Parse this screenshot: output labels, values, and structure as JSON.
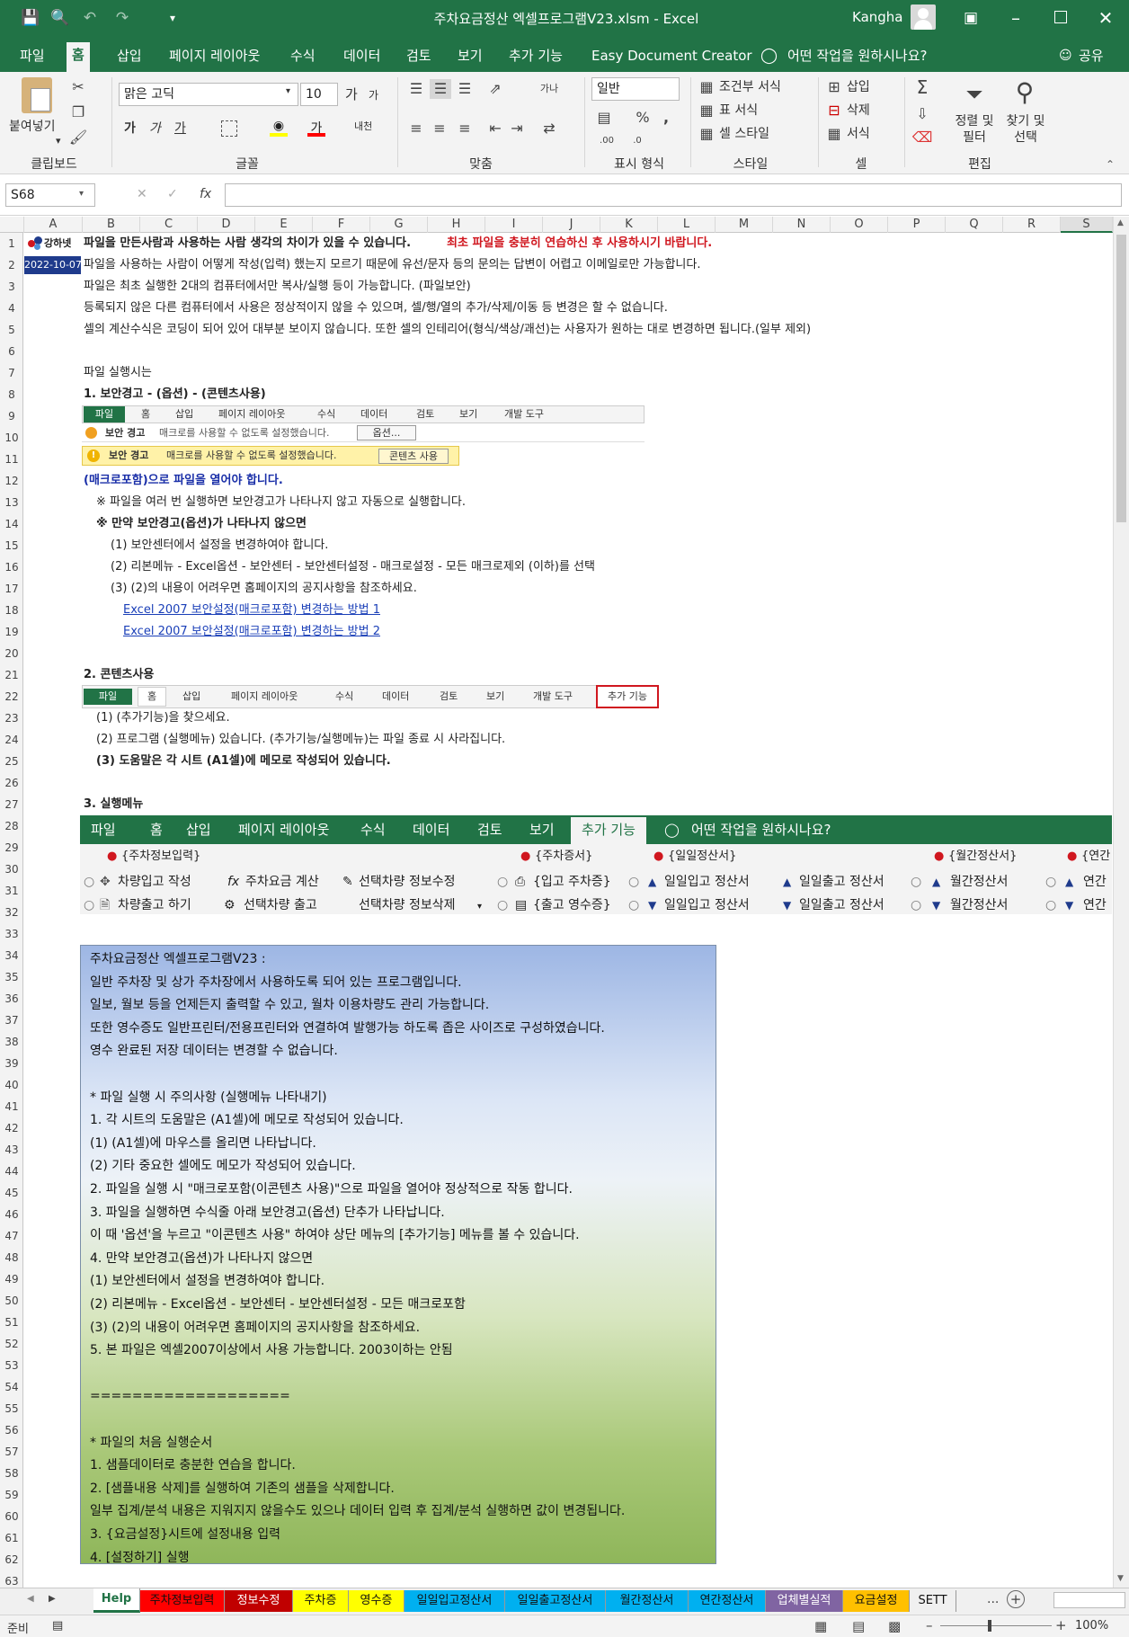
{
  "window": {
    "title": "주차요금정산 엑셀프로그램V23.xlsm  -  Excel",
    "user": "Kangha"
  },
  "menu": {
    "tabs": [
      "파일",
      "홈",
      "삽입",
      "페이지 레이아웃",
      "수식",
      "데이터",
      "검토",
      "보기",
      "추가 기능",
      "Easy Document Creator"
    ],
    "active_index": 1,
    "tell_me": "어떤 작업을 원하시나요?",
    "share": "공유"
  },
  "ribbon": {
    "clipboard": {
      "paste": "붙여넣기",
      "label": "클립보드"
    },
    "font": {
      "name": "맑은 고딕",
      "size": "10",
      "label": "글꼴"
    },
    "alignment": {
      "label": "맞춤"
    },
    "number": {
      "format": "일반",
      "label": "표시 형식"
    },
    "styles": {
      "conditional": "조건부 서식",
      "table": "표 서식",
      "cell": "셀 스타일",
      "label": "스타일"
    },
    "cells": {
      "insert": "삽입",
      "delete": "삭제",
      "format": "서식",
      "label": "셀"
    },
    "editing": {
      "sort": "정렬 및 필터",
      "find": "찾기 및 선택",
      "label": "편집"
    }
  },
  "formula_bar": {
    "name_box": "S68",
    "formula": ""
  },
  "columns": [
    "A",
    "B",
    "C",
    "D",
    "E",
    "F",
    "G",
    "H",
    "I",
    "J",
    "K",
    "L",
    "M",
    "N",
    "O",
    "P",
    "Q",
    "R",
    "S"
  ],
  "rows": [
    "1",
    "2",
    "3",
    "4",
    "5",
    "6",
    "7",
    "8",
    "9",
    "10",
    "11",
    "12",
    "13",
    "14",
    "15",
    "16",
    "17",
    "18",
    "19",
    "20",
    "21",
    "22",
    "23",
    "24",
    "25",
    "26",
    "27",
    "28",
    "29",
    "30",
    "31",
    "32",
    "33",
    "34",
    "35",
    "36",
    "37",
    "38",
    "39",
    "40",
    "41",
    "42",
    "43",
    "44",
    "45",
    "46",
    "47",
    "48",
    "49",
    "50",
    "51",
    "52",
    "53",
    "54",
    "55",
    "56",
    "57",
    "58",
    "59",
    "60",
    "61",
    "62",
    "63"
  ],
  "content": {
    "logo": "강하넷",
    "date": "2022-10-07",
    "r1a": "파일을 만든사람과 사용하는 사람 생각의 차이가 있을 수 있습니다.",
    "r1b": "최초 파일을 충분히 연습하신 후 사용하시기 바랍니다.",
    "r2": "파일을 사용하는 사람이 어떻게 작성(입력) 했는지 모르기 때문에 유선/문자 등의 문의는 답변이 어렵고 이메일로만 가능합니다.",
    "r3": "파일은 최초 실행한 2대의 컴퓨터에서만 복사/실행 등이 가능합니다.  (파일보안)",
    "r4": "등록되지 않은 다른 컴퓨터에서 사용은 정상적이지 않을 수 있으며, 셀/행/열의 추가/삭제/이동 등 변경은 할 수 없습니다.",
    "r5": "셀의 계산수식은 코딩이 되어 있어 대부분 보이지 않습니다. 또한 셀의 인테리어(형식/색상/괘선)는 사용자가 원하는 대로 변경하면 됩니다.(일부 제외)",
    "r7": "파일 실행시는",
    "r8": "1. 보안경고 - (옵션) - (콘텐츠사용)",
    "r12": "(매크로포함)으로 파일을 열어야 합니다.",
    "r13": "※ 파일을 여러 번 실행하면 보안경고가 나타나지 않고 자동으로 실행합니다.",
    "r14": "※ 만약 보안경고(옵션)가 나타나지 않으면",
    "r15": "(1) 보안센터에서 설정을 변경하여야 합니다.",
    "r16": "(2) 리본메뉴 - Excel옵션 - 보안센터 - 보안센터설정 - 매크로설정 - 모든 매크로제외 (이하)를 선택",
    "r17": "(3) (2)의 내용이 어려우면 홈페이지의 공지사항을 참조하세요.",
    "r18": "Excel 2007 보안설정(매크로포함) 변경하는 방법 1",
    "r19": "Excel 2007 보안설정(매크로포함) 변경하는 방법 2",
    "r21": "2. 콘텐츠사용",
    "r23": "(1) (추가기능)을 찾으세요.",
    "r24": "(2) 프로그램 (실행메뉴) 있습니다. (추가기능/실행메뉴)는 파일 종료 시 사라집니다.",
    "r25": "(3) 도움말은 각 시트 (A1셀)에 메모로 작성되어 있습니다.",
    "r27": "3. 실행메뉴"
  },
  "mini_ribbon1": {
    "tabs": [
      "파일",
      "홈",
      "삽입",
      "페이지 레이아웃",
      "수식",
      "데이터",
      "검토",
      "보기",
      "개발 도구"
    ],
    "warn_label": "보안 경고",
    "warn_text": "매크로를 사용할 수 없도록 설정했습니다.",
    "options": "옵션..."
  },
  "warn_bar": {
    "label": "보안 경고",
    "text": "매크로를 사용할 수 없도록 설정했습니다.",
    "button": "콘텐츠 사용"
  },
  "mini_ribbon2": {
    "tabs": [
      "파일",
      "홈",
      "삽입",
      "페이지 레이아웃",
      "수식",
      "데이터",
      "검토",
      "보기",
      "개발 도구",
      "추가 기능"
    ]
  },
  "exec_menu": {
    "tabs": [
      "파일",
      "홈",
      "삽입",
      "페이지 레이아웃",
      "수식",
      "데이터",
      "검토",
      "보기",
      "추가 기능"
    ],
    "tell_me": "어떤 작업을 원하시나요?",
    "groups": [
      "{주차정보입력}",
      "{주차증서}",
      "{일일정산서}",
      "{월간정산서}",
      "{연간"
    ],
    "row1": [
      "차량입고 작성",
      "주차요금 계산",
      "선택차량 정보수정",
      "{입고 주차증}",
      "일일입고 정산서",
      "일일출고 정산서",
      "월간정산서",
      "연간"
    ],
    "row2": [
      "차량출고 하기",
      "선택차량 출고",
      "선택차량 정보삭제",
      "{출고 영수증}",
      "일일입고 정산서",
      "일일출고 정산서",
      "월간정산서",
      "연간"
    ]
  },
  "info": {
    "lines": [
      "주차요금정산 엑셀프로그램V23 :",
      "일반 주차장 및 상가 주차장에서 사용하도록 되어 있는 프로그램입니다.",
      "일보, 월보 등을 언제든지 출력할 수 있고, 월차 이용차량도 관리 가능합니다.",
      "또한 영수증도 일반프린터/전용프린터와 연결하여 발행가능 하도록 좁은 사이즈로 구성하였습니다.",
      "영수 완료된 저장 데이터는 변경할 수 없습니다.",
      "",
      "* 파일 실행 시 주의사항 (실행메뉴 나타내기)",
      "1. 각 시트의 도움말은 (A1셀)에 메모로 작성되어 있습니다.",
      "  (1) (A1셀)에 마우스를 올리면 나타납니다.",
      "  (2) 기타 중요한 셀에도 메모가 작성되어 있습니다.",
      "2. 파일을 실행 시 \"매크로포함(이콘텐츠 사용)\"으로 파일을 열어야 정상적으로 작동 합니다.",
      "3. 파일을 실행하면 수식줄 아래 보안경고(옵션) 단추가 나타납니다.",
      "   이 때 '옵션'을 누르고 \"이콘텐츠 사용\" 하여야 상단 메뉴의 [추가기능] 메뉴를 볼 수 있습니다.",
      "4. 만약 보안경고(옵션)가 나타나지 않으면",
      "  (1) 보안센터에서 설정을 변경하여야 합니다.",
      "  (2) 리본메뉴 - Excel옵션 - 보안센터 - 보안센터설정 - 모든 매크로포함",
      "  (3) (2)의 내용이 어려우면 홈페이지의 공지사항을 참조하세요.",
      "5. 본 파일은 엑셀2007이상에서 사용 가능합니다. 2003이하는 안됨",
      "",
      "===================",
      "",
      "* 파일의 처음 실행순서",
      "1. 샘플데이터로 충분한 연습을 합니다.",
      "2. [샘플내용 삭제]를 실행하여 기존의 샘플을 삭제합니다.",
      "   일부 집계/분석 내용은 지워지지 않을수도 있으나 데이터 입력 후 집계/분석 실행하면 값이 변경됩니다.",
      "3. {요금설정}시트에 설정내용 입력",
      "4. [설정하기] 실행"
    ]
  },
  "sheet_tabs": [
    {
      "name": "Help",
      "color": "#ffffff",
      "text": "#217346"
    },
    {
      "name": "주차정보입력",
      "color": "#ff0000",
      "text": "#111111"
    },
    {
      "name": "정보수정",
      "color": "#c00000",
      "text": "#ffffff"
    },
    {
      "name": "주차증",
      "color": "#ffff00",
      "text": "#111111"
    },
    {
      "name": "영수증",
      "color": "#ffff00",
      "text": "#111111"
    },
    {
      "name": "일일입고정산서",
      "color": "#00b0f0",
      "text": "#111111"
    },
    {
      "name": "일일출고정산서",
      "color": "#00b0f0",
      "text": "#111111"
    },
    {
      "name": "월간정산서",
      "color": "#00b0f0",
      "text": "#111111"
    },
    {
      "name": "연간정산서",
      "color": "#00b0f0",
      "text": "#111111"
    },
    {
      "name": "업체별실적",
      "color": "#8064a2",
      "text": "#ffffff"
    },
    {
      "name": "요금설정",
      "color": "#ffc000",
      "text": "#111111"
    },
    {
      "name": "SETT",
      "color": "#f0f0f0",
      "text": "#111111"
    }
  ],
  "status": {
    "ready": "준비",
    "zoom": "100%"
  },
  "colors": {
    "excel_green": "#217346",
    "title_red": "#d0171f",
    "date_bg": "#1f3b8c"
  }
}
